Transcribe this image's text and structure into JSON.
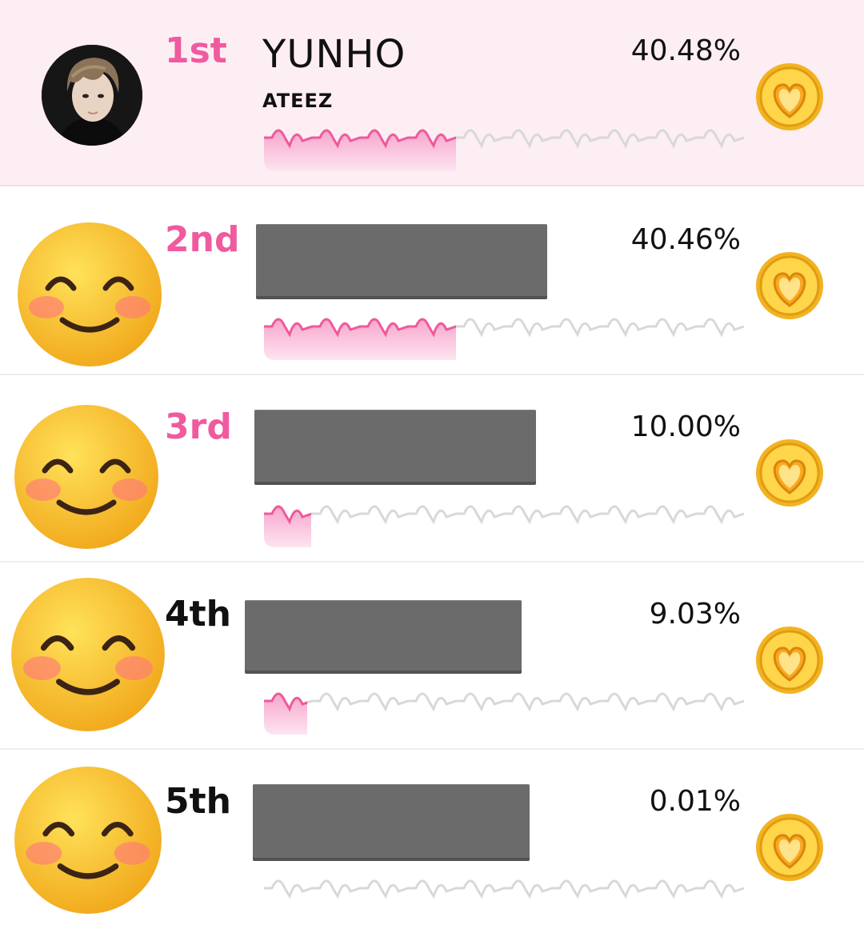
{
  "colors": {
    "accent_pink": "#f05a9e",
    "highlight_row": "#fdeef4",
    "dark_text": "#111111"
  },
  "ranking": [
    {
      "rank": "1st",
      "name": "YUNHO",
      "group": "ATEEZ",
      "percent": "40.48%",
      "share": 0.4048,
      "avatar": "artist-photo",
      "highlighted": true
    },
    {
      "rank": "2nd",
      "name": "",
      "group": "",
      "percent": "40.46%",
      "share": 0.4046,
      "avatar": "smiling-emoji",
      "highlighted": false
    },
    {
      "rank": "3rd",
      "name": "",
      "group": "",
      "percent": "10.00%",
      "share": 0.1,
      "avatar": "smiling-emoji",
      "highlighted": false
    },
    {
      "rank": "4th",
      "name": "",
      "group": "",
      "percent": "9.03%",
      "share": 0.0903,
      "avatar": "smiling-emoji",
      "highlighted": false
    },
    {
      "rank": "5th",
      "name": "",
      "group": "",
      "percent": "0.01%",
      "share": 0.0001,
      "avatar": "smiling-emoji",
      "highlighted": false
    }
  ],
  "icons": {
    "vote": "heart-coin-icon"
  }
}
